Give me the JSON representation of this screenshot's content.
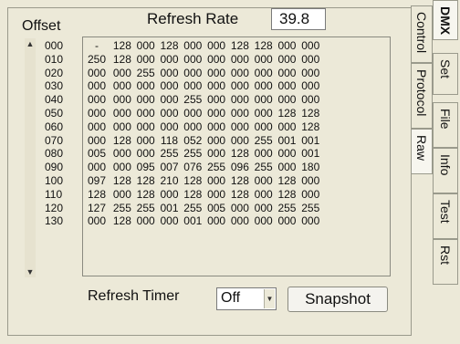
{
  "header": {
    "offset_label": "Offset",
    "refresh_rate_label": "Refresh Rate",
    "refresh_rate_value": "39.8"
  },
  "offsets": [
    "000",
    "010",
    "020",
    "030",
    "040",
    "050",
    "060",
    "070",
    "080",
    "090",
    "100",
    "110",
    "120",
    "130"
  ],
  "grid": [
    [
      "-",
      "128",
      "000",
      "128",
      "000",
      "000",
      "128",
      "128",
      "000",
      "000"
    ],
    [
      "250",
      "128",
      "000",
      "000",
      "000",
      "000",
      "000",
      "000",
      "000",
      "000"
    ],
    [
      "000",
      "000",
      "255",
      "000",
      "000",
      "000",
      "000",
      "000",
      "000",
      "000"
    ],
    [
      "000",
      "000",
      "000",
      "000",
      "000",
      "000",
      "000",
      "000",
      "000",
      "000"
    ],
    [
      "000",
      "000",
      "000",
      "000",
      "255",
      "000",
      "000",
      "000",
      "000",
      "000"
    ],
    [
      "000",
      "000",
      "000",
      "000",
      "000",
      "000",
      "000",
      "000",
      "128",
      "128"
    ],
    [
      "000",
      "000",
      "000",
      "000",
      "000",
      "000",
      "000",
      "000",
      "000",
      "128"
    ],
    [
      "000",
      "128",
      "000",
      "118",
      "052",
      "000",
      "000",
      "255",
      "001",
      "001"
    ],
    [
      "005",
      "000",
      "000",
      "255",
      "255",
      "000",
      "128",
      "000",
      "000",
      "001"
    ],
    [
      "000",
      "000",
      "095",
      "007",
      "076",
      "255",
      "096",
      "255",
      "000",
      "180"
    ],
    [
      "097",
      "128",
      "128",
      "210",
      "128",
      "000",
      "128",
      "000",
      "128",
      "000"
    ],
    [
      "128",
      "000",
      "128",
      "000",
      "128",
      "000",
      "128",
      "000",
      "128",
      "000"
    ],
    [
      "127",
      "255",
      "255",
      "001",
      "255",
      "005",
      "000",
      "000",
      "255",
      "255"
    ],
    [
      "000",
      "128",
      "000",
      "000",
      "001",
      "000",
      "000",
      "000",
      "000",
      "000"
    ]
  ],
  "footer": {
    "refresh_timer_label": "Refresh Timer",
    "refresh_timer_value": "Off",
    "snapshot_label": "Snapshot"
  },
  "tabs": {
    "inner": [
      "Control",
      "Protocol",
      "Raw"
    ],
    "outer": [
      "DMX",
      "Set",
      "File",
      "Info",
      "Test",
      "Rst"
    ]
  },
  "icons": {
    "scroll_up": "arrow-up-icon",
    "scroll_down": "arrow-down-icon",
    "select_arrow": "chevron-down-icon"
  }
}
